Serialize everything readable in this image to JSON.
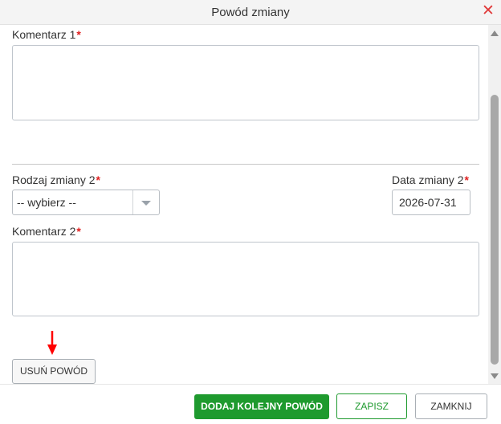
{
  "dialog": {
    "title": "Powód zmiany",
    "close_symbol": "✕"
  },
  "form": {
    "comment1_label": "Komentarz 1",
    "comment1_value": "",
    "change_type2_label": "Rodzaj zmiany 2",
    "change_type2_value": "-- wybierz --",
    "change_date2_label": "Data zmiany 2",
    "change_date2_value": "2026-07-31",
    "comment2_label": "Komentarz 2",
    "comment2_value": "",
    "required_marker": "*"
  },
  "buttons": {
    "remove_reason": "USUŃ POWÓD",
    "add_reason": "DODAJ KOLEJNY POWÓD",
    "save": "ZAPISZ",
    "close": "ZAMKNIJ"
  },
  "icons": {
    "close": "close-icon",
    "dropdown": "chevron-down-icon",
    "annotation": "red-arrow-down-icon",
    "scroll_up": "scroll-up-icon",
    "scroll_down": "scroll-down-icon"
  },
  "colors": {
    "primary_green": "#1e9a2e",
    "required_red": "#e02020",
    "arrow_red": "#ff0000"
  }
}
